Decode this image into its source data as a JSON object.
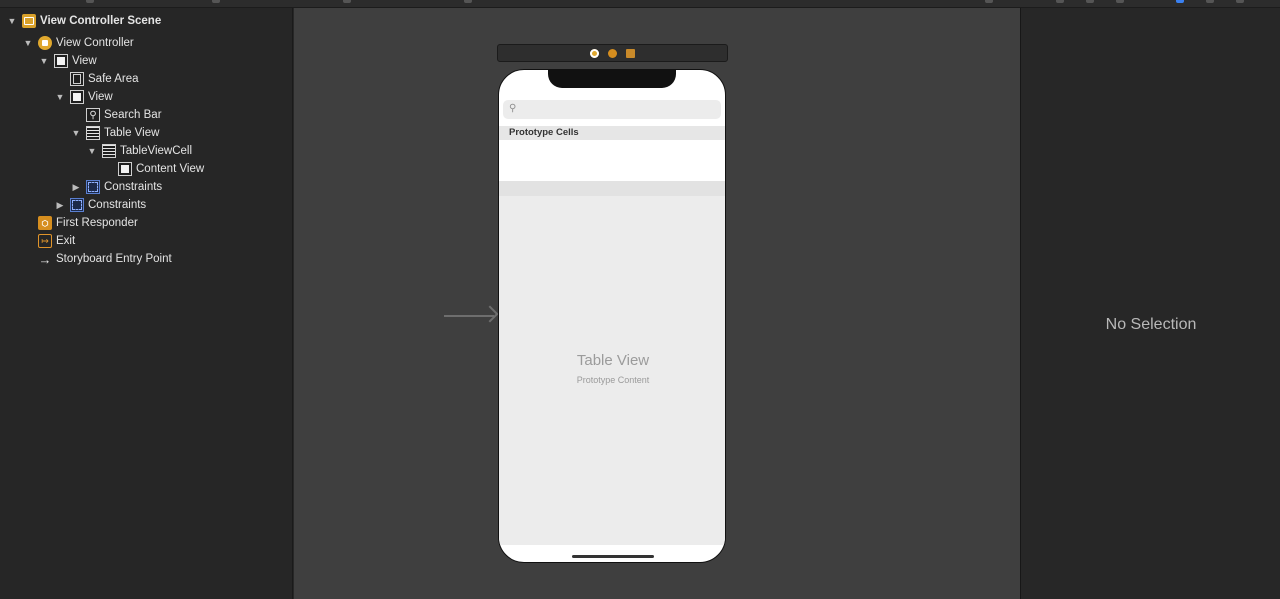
{
  "outline": {
    "items": [
      {
        "label": "View Controller Scene",
        "icon": "scene-icon",
        "disclosure": "expanded"
      },
      {
        "label": "View Controller",
        "icon": "view-controller-icon",
        "disclosure": "expanded"
      },
      {
        "label": "View",
        "icon": "view-icon",
        "disclosure": "expanded"
      },
      {
        "label": "Safe Area",
        "icon": "safe-area-icon",
        "disclosure": "none"
      },
      {
        "label": "View",
        "icon": "view-icon",
        "disclosure": "expanded"
      },
      {
        "label": "Search Bar",
        "icon": "search-bar-icon",
        "disclosure": "none"
      },
      {
        "label": "Table View",
        "icon": "table-view-icon",
        "disclosure": "expanded"
      },
      {
        "label": "TableViewCell",
        "icon": "table-view-cell-icon",
        "disclosure": "expanded"
      },
      {
        "label": "Content View",
        "icon": "view-icon",
        "disclosure": "none"
      },
      {
        "label": "Constraints",
        "icon": "constraints-icon",
        "disclosure": "collapsed"
      },
      {
        "label": "Constraints",
        "icon": "constraints-icon",
        "disclosure": "collapsed"
      },
      {
        "label": "First Responder",
        "icon": "first-responder-icon",
        "disclosure": "none"
      },
      {
        "label": "Exit",
        "icon": "exit-icon",
        "disclosure": "none"
      },
      {
        "label": "Storyboard Entry Point",
        "icon": "entry-arrow-icon",
        "disclosure": "none"
      }
    ]
  },
  "canvas": {
    "prototype_cells_label": "Prototype Cells",
    "table_view_title": "Table View",
    "table_view_subtitle": "Prototype Content",
    "scene_dock_icons": [
      "view-controller-icon",
      "first-responder-icon",
      "exit-icon"
    ]
  },
  "inspector": {
    "empty_label": "No Selection"
  },
  "colors": {
    "accent": "#e0a82e",
    "canvas_bg": "#3f3f3f",
    "sidebar_bg": "#262626"
  }
}
